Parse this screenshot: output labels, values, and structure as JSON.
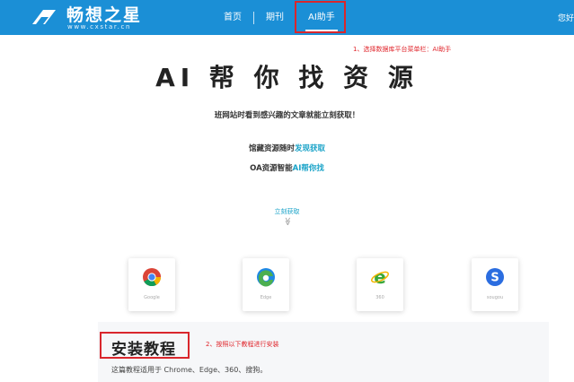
{
  "header": {
    "logo_text": "畅想之星",
    "logo_sub": "www.cxstar.cn",
    "nav": [
      {
        "label": "首页"
      },
      {
        "label": "期刊"
      },
      {
        "label": "AI助手"
      }
    ],
    "greeting": "您好",
    "accent_color": "#1b8fd6"
  },
  "annotations": {
    "step1": "1、选择数据库平台菜单栏：AI助手",
    "step2": "2、按照以下教程进行安装",
    "color": "#d9262c"
  },
  "hero": {
    "title": "AI 帮 你 找 资 源",
    "subtitle": "班网站时看到感兴趣的文章就能立刻获取！",
    "line1_prefix": "馆藏资源随时",
    "line1_accent": "发现获取",
    "line2_prefix": "OA资源智能",
    "line2_accent": "AI帮你找",
    "get_now": "立刻获取",
    "chevron": "≫"
  },
  "browsers": [
    {
      "name": "Google",
      "icon": "chrome-icon"
    },
    {
      "name": "Edge",
      "icon": "edge-icon"
    },
    {
      "name": "360",
      "icon": "ie-360-icon"
    },
    {
      "name": "sougou",
      "icon": "sogou-icon"
    }
  ],
  "install": {
    "title": "安装教程",
    "note": "这篇教程适用于 Chrome、Edge、360、搜狗。"
  }
}
